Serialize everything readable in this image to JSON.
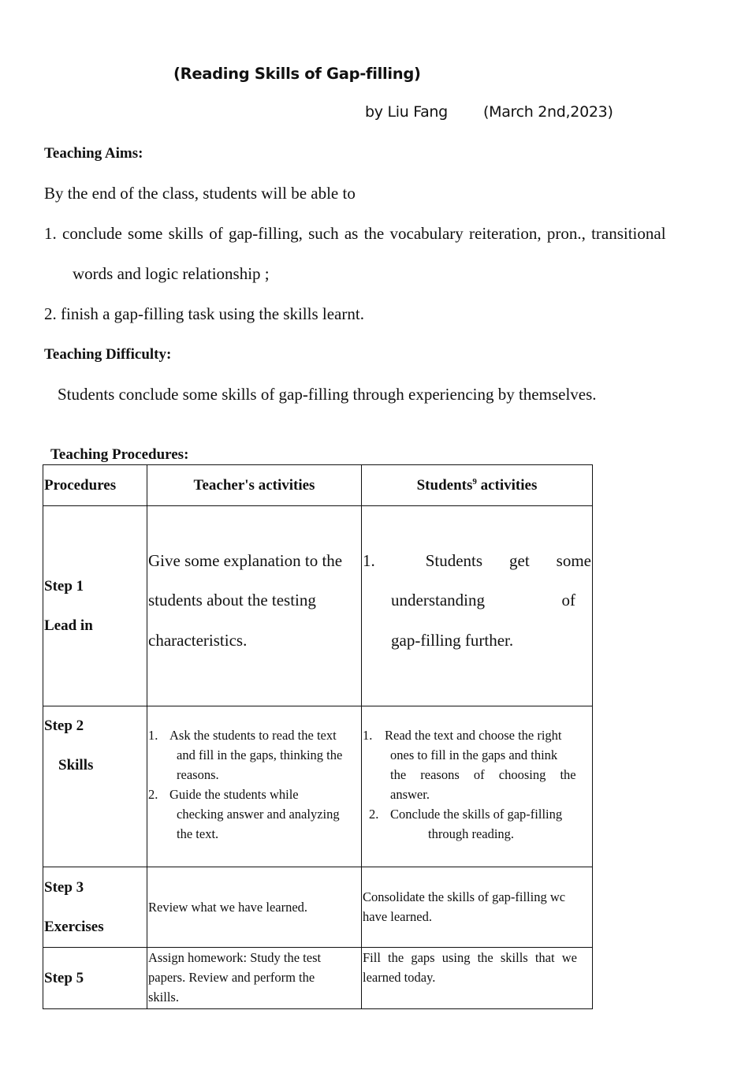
{
  "document": {
    "title": "(Reading Skills of Gap-filling)",
    "author": "by Liu Fang",
    "date": "(March 2nd,2023)"
  },
  "teaching_aims": {
    "heading": "Teaching Aims:",
    "intro": "By the end of the class, students will be able to",
    "aims": [
      {
        "line1": "1. conclude some skills of gap-filling, such as the vocabulary reiteration, pron., transitional",
        "line2": "words and logic relationship ;"
      },
      {
        "line1": "2.  finish a gap-filling task using the skills learnt."
      }
    ]
  },
  "teaching_difficulty": {
    "heading": "Teaching Difficulty:",
    "text": "Students conclude some skills of gap-filling through experiencing by themselves."
  },
  "teaching_procedures": {
    "heading": "Teaching Procedures:",
    "columns": {
      "procedures": "Procedures",
      "teacher": "Teacher's activities",
      "students_prefix": "Students",
      "students_superscript": "9",
      "students_suffix": " activities"
    },
    "rows": [
      {
        "step": "Step 1",
        "step_name": "Lead in",
        "teacher_lines": [
          "Give some explanation to the",
          "students about the testing",
          "characteristics."
        ],
        "student_number": "1.",
        "student_lines": [
          [
            "Students",
            "get",
            "some"
          ],
          [
            "understanding",
            "of"
          ],
          [
            "gap-filling further."
          ]
        ]
      },
      {
        "step": "Step 2",
        "step_name": "Skills",
        "teacher_items": [
          {
            "num": "1.",
            "first": "Ask the students to read the text",
            "rest": [
              "and fill in the gaps, thinking the",
              "reasons."
            ]
          },
          {
            "num": "2.",
            "first": "Guide the students while",
            "rest": [
              "checking answer and analyzing",
              "the text."
            ]
          }
        ],
        "student_items": [
          {
            "num": "1.",
            "first": "Read the text and choose the right",
            "rest": [
              "ones to fill in the gaps and think",
              "the reasons of choosing the",
              "answer."
            ]
          },
          {
            "num": "2.",
            "first": "Conclude the skills of gap-filling",
            "rest": [
              "through reading."
            ]
          }
        ]
      },
      {
        "step": "Step 3",
        "step_name": "Exercises",
        "teacher": "Review what we have learned.",
        "student_lines": [
          "Consolidate the skills of gap-filling wc",
          "have learned."
        ]
      },
      {
        "step": "Step 5",
        "teacher_lines": [
          "Assign homework: Study the test",
          "papers. Review and perform the",
          "skills."
        ],
        "student_lines": [
          "Fill the gaps using the skills that we",
          "learned today."
        ]
      }
    ]
  }
}
